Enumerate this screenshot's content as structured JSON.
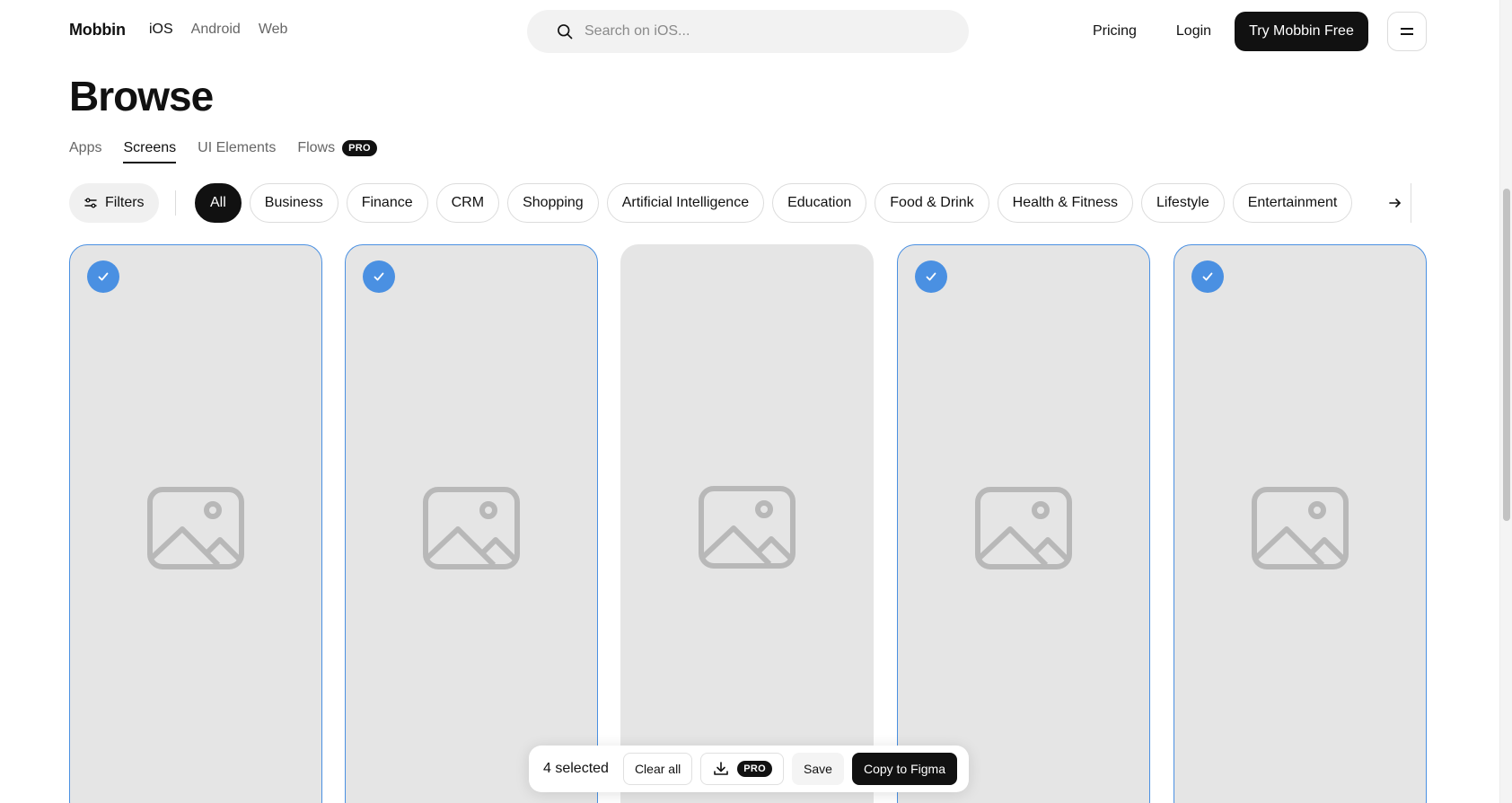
{
  "header": {
    "logo": "Mobbin",
    "platforms": [
      {
        "label": "iOS",
        "active": true
      },
      {
        "label": "Android",
        "active": false
      },
      {
        "label": "Web",
        "active": false
      }
    ],
    "search_placeholder": "Search on iOS...",
    "pricing": "Pricing",
    "login": "Login",
    "cta": "Try Mobbin Free",
    "menu_icon": "menu-icon"
  },
  "page": {
    "title": "Browse"
  },
  "tabs": [
    {
      "label": "Apps",
      "active": false
    },
    {
      "label": "Screens",
      "active": true
    },
    {
      "label": "UI Elements",
      "active": false
    },
    {
      "label": "Flows",
      "active": false,
      "badge": "PRO"
    }
  ],
  "filters": {
    "button_label": "Filters",
    "chips": [
      {
        "label": "All",
        "active": true
      },
      {
        "label": "Business",
        "active": false
      },
      {
        "label": "Finance",
        "active": false
      },
      {
        "label": "CRM",
        "active": false
      },
      {
        "label": "Shopping",
        "active": false
      },
      {
        "label": "Artificial Intelligence",
        "active": false
      },
      {
        "label": "Education",
        "active": false
      },
      {
        "label": "Food & Drink",
        "active": false
      },
      {
        "label": "Health & Fitness",
        "active": false
      },
      {
        "label": "Lifestyle",
        "active": false
      },
      {
        "label": "Entertainment",
        "active": false
      }
    ]
  },
  "cards": [
    {
      "selected": true
    },
    {
      "selected": true
    },
    {
      "selected": false
    },
    {
      "selected": true
    },
    {
      "selected": true
    }
  ],
  "selection_bar": {
    "count_label": "4 selected",
    "clear_all": "Clear all",
    "download_badge": "PRO",
    "save": "Save",
    "copy_to_figma": "Copy to Figma"
  },
  "colors": {
    "accent": "#4a90e2",
    "dark": "#111111",
    "card_bg": "#e5e5e5"
  }
}
